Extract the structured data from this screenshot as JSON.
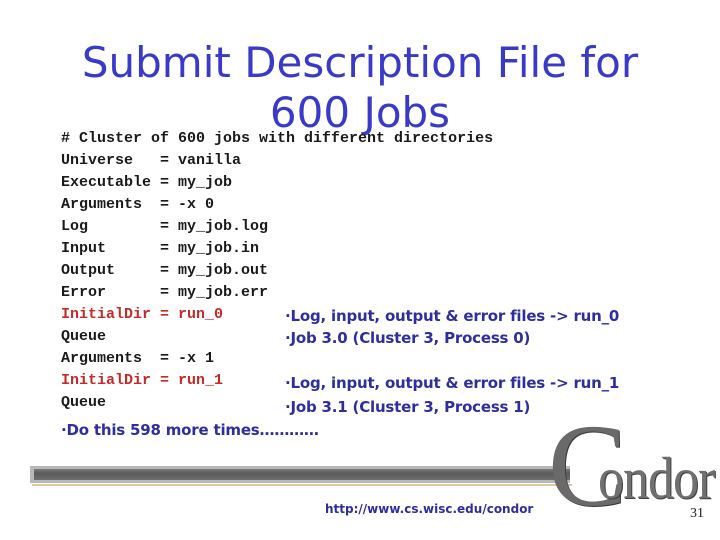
{
  "slide": {
    "title_line1": "Submit Description File for",
    "title_line2": "600 Jobs",
    "colors": {
      "title": "#3a3ac8",
      "code_text": "#1a1a1a",
      "highlight": "#c42a2a",
      "annotation": "#2e2e9e"
    }
  },
  "code_lines": [
    {
      "text": "# Cluster of 600 jobs with different directories",
      "highlight": false
    },
    {
      "text": "Universe   = vanilla",
      "highlight": false
    },
    {
      "text": "Executable = my_job",
      "highlight": false
    },
    {
      "text": "Arguments  = -x 0",
      "highlight": false
    },
    {
      "text": "Log        = my_job.log",
      "highlight": false
    },
    {
      "text": "Input      = my_job.in",
      "highlight": false
    },
    {
      "text": "Output     = my_job.out",
      "highlight": false
    },
    {
      "text": "Error      = my_job.err",
      "highlight": false
    },
    {
      "text": "InitialDir = run_0",
      "highlight": true
    },
    {
      "text": "Queue",
      "highlight": false
    },
    {
      "text": "Arguments  = -x 1",
      "highlight": false
    },
    {
      "text": "InitialDir = run_1",
      "highlight": true
    },
    {
      "text": "Queue",
      "highlight": false
    }
  ],
  "annotations": {
    "run0_files": "·Log, input, output & error files -> run_0",
    "run0_job": "·Job 3.0 (Cluster 3, Process 0)",
    "run1_files": "·Log, input, output & error files -> run_1",
    "run1_job": "·Job 3.1 (Cluster 3, Process 1)",
    "repeat": "·Do this 598 more times…………"
  },
  "footer": {
    "logo_initial": "C",
    "logo_rest": "ondor",
    "url": "http://www.cs.wisc.edu/condor",
    "page_number": "31"
  }
}
